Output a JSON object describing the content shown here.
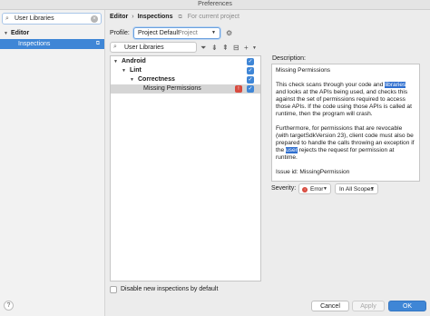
{
  "window": {
    "title": "Preferences"
  },
  "sidebar": {
    "search_value": "User Libraries",
    "editor_label": "Editor",
    "inspections_label": "Inspections"
  },
  "breadcrumb": {
    "part1": "Editor",
    "part2": "Inspections",
    "note": "For current project"
  },
  "profile": {
    "label": "Profile:",
    "value": "Project Default",
    "scope": "Project"
  },
  "toolbar": {
    "search_value": "User Libraries"
  },
  "tree": {
    "android": "Android",
    "lint": "Lint",
    "correctness": "Correctness",
    "missing_permissions": "Missing Permissions"
  },
  "disable_new_label": "Disable new inspections by default",
  "description": {
    "label": "Description:",
    "title": "Missing Permissions",
    "p1_a": "This check scans through your code and ",
    "p1_hl": "libraries",
    "p1_b": " and looks at the APIs being used, and checks this against the set of permissions required to access those APIs. If the code using those APIs is called at runtime, then the program will crash.",
    "p2_a": "Furthermore, for permissions that are revocable (with targetSdkVersion 23), client code must also be prepared to handle the calls throwing an exception if the ",
    "p2_hl": "user",
    "p2_b": " rejects the request for permission at runtime.",
    "issue_id": "Issue id: MissingPermission"
  },
  "severity": {
    "label": "Severity:",
    "value": "Error",
    "scope": "In All Scopes"
  },
  "buttons": {
    "cancel": "Cancel",
    "apply": "Apply",
    "ok": "OK"
  },
  "help_label": "?"
}
